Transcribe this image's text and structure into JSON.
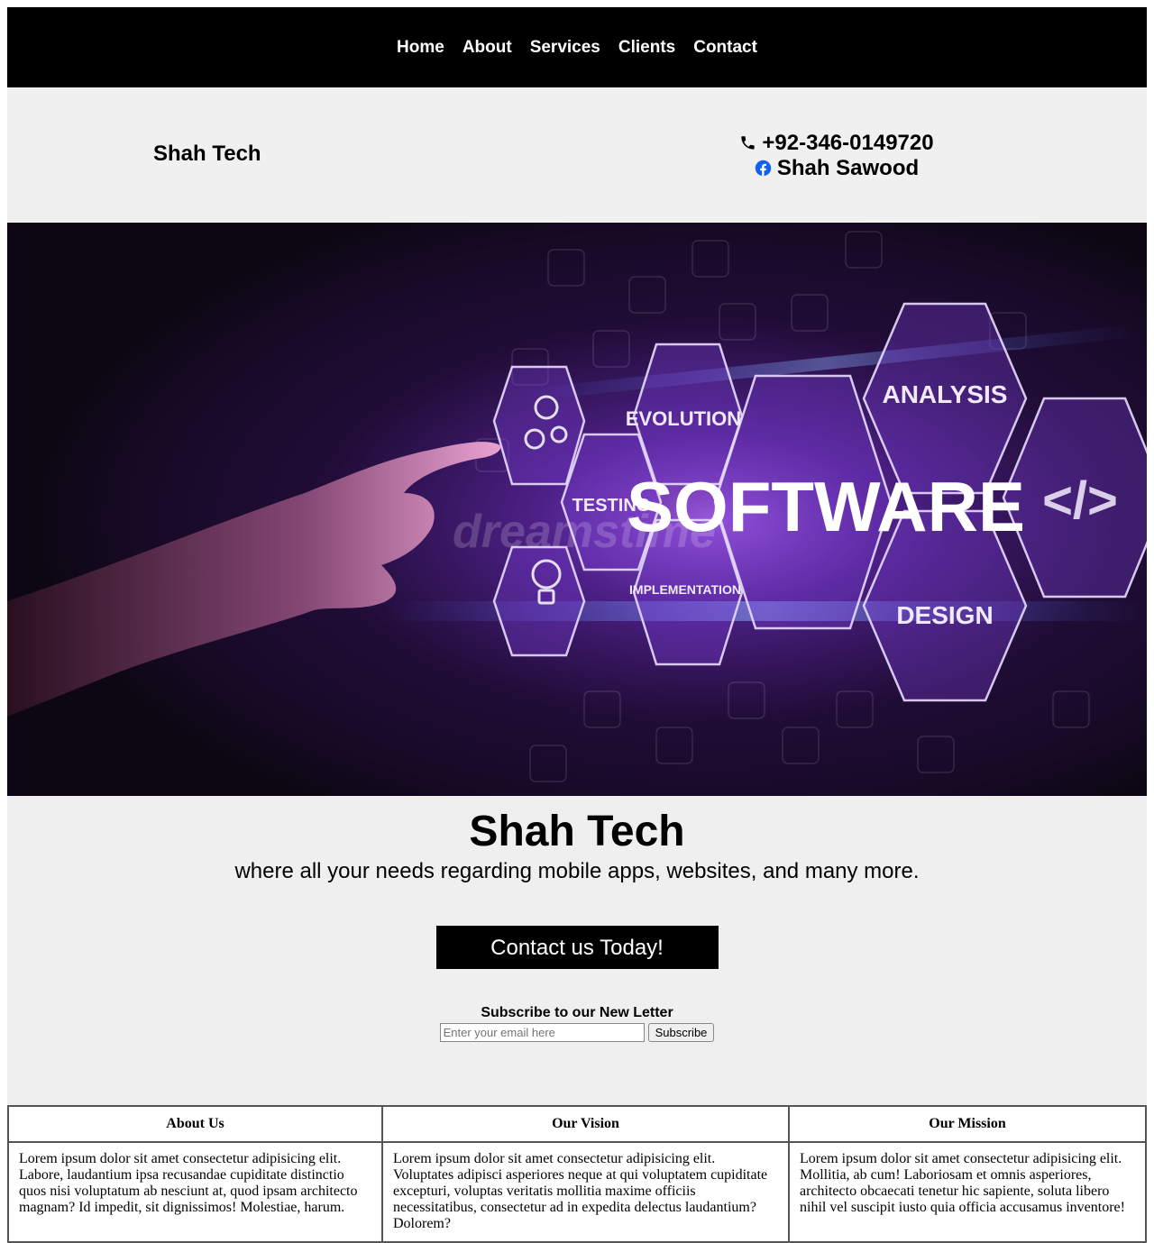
{
  "nav": {
    "items": [
      "Home",
      "About",
      "Services",
      "Clients",
      "Contact"
    ]
  },
  "header": {
    "brand": "Shah Tech",
    "phone": "+92-346-0149720",
    "facebook": "Shah Sawood"
  },
  "hero": {
    "words": {
      "software": "SOFTWARE",
      "evolution": "EVOLUTION",
      "testing": "TESTING",
      "implementation": "IMPLEMENTATION",
      "analysis": "ANALYSIS",
      "design": "DESIGN",
      "code": "</>"
    },
    "watermark": "dreamstime"
  },
  "intro": {
    "title": "Shah Tech",
    "tagline": "where all your needs regarding mobile apps, websites, and many more.",
    "cta": "Contact us Today!",
    "subscribe_title": "Subscribe to our New Letter",
    "email_placeholder": "Enter your email here",
    "subscribe_button": "Subscribe"
  },
  "info_table": {
    "headers": [
      "About Us",
      "Our Vision",
      "Our Mission"
    ],
    "cells": [
      "Lorem ipsum dolor sit amet consectetur adipisicing elit. Labore, laudantium ipsa recusandae cupiditate distinctio quos nisi voluptatum ab nesciunt at, quod ipsam architecto magnam? Id impedit, sit dignissimos! Molestiae, harum.",
      "Lorem ipsum dolor sit amet consectetur adipisicing elit. Voluptates adipisci asperiores neque at qui voluptatem cupiditate excepturi, voluptas veritatis mollitia maxime officiis necessitatibus, consectetur ad in expedita delectus laudantium? Dolorem?",
      "Lorem ipsum dolor sit amet consectetur adipisicing elit. Mollitia, ab cum! Laboriosam et omnis asperiores, architecto obcaecati tenetur hic sapiente, soluta libero nihil vel suscipit iusto quia officia accusamus inventore!"
    ]
  },
  "colors": {
    "nav_bg": "#000000",
    "section_bg": "#f0f0f0",
    "cta_bg": "#000000",
    "facebook_blue": "#1877f2"
  }
}
